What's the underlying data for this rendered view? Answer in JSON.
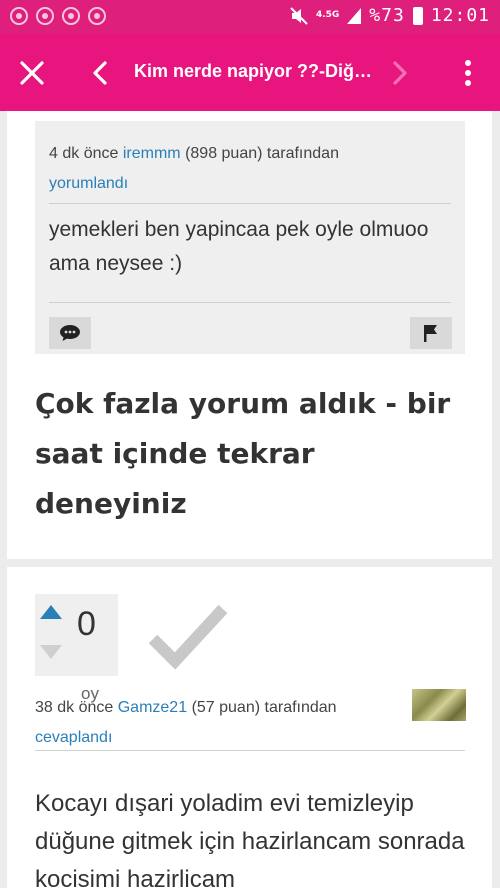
{
  "status_bar": {
    "network": "4.5G",
    "battery": "%73",
    "time": "12:01",
    "icons": [
      "chrome-icon",
      "chrome-icon",
      "chrome-icon",
      "chrome-icon",
      "mute-icon",
      "signal-icon",
      "battery-icon"
    ]
  },
  "toolbar": {
    "title": "Kim nerde napiyor ??-Diğ…",
    "icons": [
      "close-icon",
      "back-arrow-icon",
      "forward-arrow-icon",
      "overflow-menu-icon"
    ],
    "background": "#e8157f"
  },
  "comment": {
    "meta_prefix": "4 dk önce",
    "user": "iremmm",
    "points": "(898 puan)",
    "suffix": "tarafından",
    "action": "yorumlandı",
    "text": "yemekleri ben yapincaa pek oyle olmuoo ama neysee :)",
    "buttons": [
      "comment-icon",
      "flag-icon"
    ]
  },
  "notice": "Çok fazla yorum aldık - bir saat içinde tekrar deneyiniz",
  "answer": {
    "votes": "0",
    "votes_label": "oy",
    "meta_prefix": "38 dk önce",
    "user": "Gamze21",
    "points": "(57 puan)",
    "suffix": "tarafından",
    "action": "cevaplandı",
    "text": "Kocayı dışari yoladim evi temizleyip düğune gitmek için hazirlancam sonrada kocisimi hazirlicam"
  },
  "colors": {
    "accent": "#e8157f",
    "link": "#2b7fb8",
    "vote_up": "#2b7fb8"
  }
}
